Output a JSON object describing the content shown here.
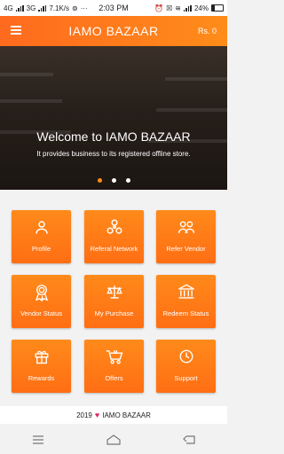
{
  "status_bar": {
    "network_1": "4G",
    "network_2": "3G",
    "speed": "7.1K/s",
    "more": "···",
    "time": "2:03 PM",
    "battery": "24%"
  },
  "app_bar": {
    "title": "IAMO BAZAAR",
    "balance": "Rs. 0"
  },
  "banner": {
    "title": "Welcome to IAMO BAZAAR",
    "subtitle": "It provides business to its registered offline store.",
    "slides": 3,
    "active_slide": 1
  },
  "tiles": [
    {
      "label": "Profile",
      "icon": "person-icon"
    },
    {
      "label": "Referal Network",
      "icon": "network-icon"
    },
    {
      "label": "Refer Vendor",
      "icon": "people-icon"
    },
    {
      "label": "Vendor Status",
      "icon": "badge-icon"
    },
    {
      "label": "My Purchase",
      "icon": "scale-icon"
    },
    {
      "label": "Redeem Status",
      "icon": "bank-icon"
    },
    {
      "label": "Rewards",
      "icon": "gift-icon"
    },
    {
      "label": "Offers",
      "icon": "cart-icon"
    },
    {
      "label": "Support",
      "icon": "clock-icon"
    }
  ],
  "footer": {
    "year": "2019",
    "brand": "IAMO BAZAAR"
  },
  "colors": {
    "accent": "#ff7a1a",
    "heart": "#e0245e"
  }
}
